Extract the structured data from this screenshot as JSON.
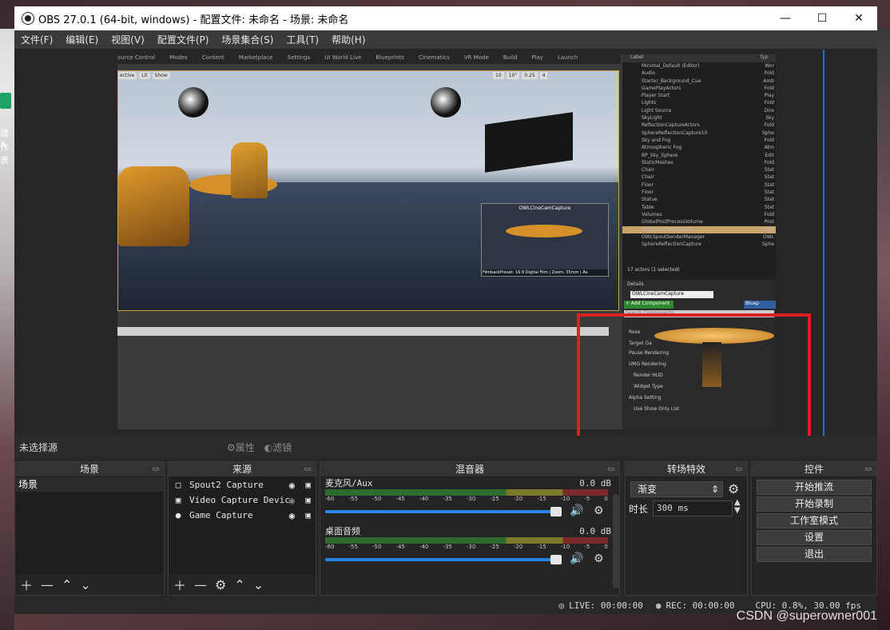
{
  "window": {
    "title": "OBS 27.0.1 (64-bit, windows) - 配置文件: 未命名 - 场景: 未命名"
  },
  "menu": [
    "文件(F)",
    "编辑(E)",
    "视图(V)",
    "配置文件(P)",
    "场景集合(S)",
    "工具(T)",
    "帮助(H)"
  ],
  "desktop": {
    "left_text": [
      "建 X",
      "作表"
    ]
  },
  "ue": {
    "top_tabs": [
      "ource Control",
      "Modes",
      "Content",
      "Marketplace",
      "Settings",
      "UI World Live",
      "Blueprints",
      "Cinematics",
      "VR Mode",
      "Build",
      "Play",
      "Launch"
    ],
    "view_buttons": [
      "ective",
      "Lit",
      "Show"
    ],
    "snap_values": [
      "10",
      "10°",
      "0.25",
      "4"
    ],
    "pip_title": "OWLCineCamCapture",
    "pip_caption": "FilmbackPreset: 16:9 Digital Film | Zoom: 35mm | Av.",
    "outliner_header": {
      "label": "Label",
      "type": "Typ"
    },
    "outliner_rows": [
      {
        "name": "Minimal_Default (Editor)",
        "type": "Wor"
      },
      {
        "name": "Audio",
        "type": "Fold"
      },
      {
        "name": "Starter_Background_Cue",
        "type": "Amb"
      },
      {
        "name": "GamePlayActors",
        "type": "Fold"
      },
      {
        "name": "Player Start",
        "type": "Play"
      },
      {
        "name": "Lights",
        "type": "Fold"
      },
      {
        "name": "Light Source",
        "type": "Dire"
      },
      {
        "name": "SkyLight",
        "type": "Sky"
      },
      {
        "name": "ReflectionCaptureActors",
        "type": "Fold"
      },
      {
        "name": "SphereReflectionCapture10",
        "type": "Sphe"
      },
      {
        "name": "Sky and Fog",
        "type": "Fold"
      },
      {
        "name": "Atmospheric Fog",
        "type": "Atm"
      },
      {
        "name": "BP_Sky_Sphere",
        "type": "Edit"
      },
      {
        "name": "StaticMeshes",
        "type": "Fold"
      },
      {
        "name": "Chair",
        "type": "Stat"
      },
      {
        "name": "Chair",
        "type": "Stat"
      },
      {
        "name": "Floor",
        "type": "Stat"
      },
      {
        "name": "Floor",
        "type": "Stat"
      },
      {
        "name": "Statue",
        "type": "Stat"
      },
      {
        "name": "Table",
        "type": "Stat"
      },
      {
        "name": "Volumes",
        "type": "Fold"
      },
      {
        "name": "GlobalPostProcessVolume",
        "type": "Post"
      },
      {
        "name": "OWLCineCamCapture",
        "type": "OWL"
      },
      {
        "name": "OWLSpoutSenderManager",
        "type": "OWL"
      },
      {
        "name": "SphereReflectionCapture",
        "type": "Sphe"
      }
    ],
    "actor_count": "17 actors (1 selected)",
    "details_tab": "Details",
    "details_name": "OWLCineCamCapture",
    "add_component": "+ Add Component",
    "blueprint": "Bluep",
    "search_components": "Search Components",
    "detail_rows": [
      "Rese",
      "Target Ga",
      "Pause Rendering",
      "UMG Rendering",
      "Render HUD",
      "Widget Type",
      "Alpha Setting",
      "Use Show Only List"
    ]
  },
  "source_bar": {
    "no_source": "未选择源",
    "properties": "属性",
    "filters": "滤镜"
  },
  "panels": {
    "scenes": {
      "title": "场景",
      "items": [
        "场景"
      ]
    },
    "sources": {
      "title": "来源",
      "items": [
        "Spout2 Capture",
        "Video Capture Devic",
        "Game Capture"
      ]
    },
    "mixer": {
      "title": "混音器",
      "channels": [
        {
          "name": "麦克风/Aux",
          "db": "0.0 dB"
        },
        {
          "name": "桌面音频",
          "db": "0.0 dB"
        }
      ],
      "ticks": [
        "-60",
        "-55",
        "-50",
        "-45",
        "-40",
        "-35",
        "-30",
        "-25",
        "-20",
        "-15",
        "-10",
        "-5",
        "0"
      ]
    },
    "transitions": {
      "title": "转场特效",
      "selected": "渐变",
      "duration_label": "时长",
      "duration_value": "300 ms"
    },
    "controls": {
      "title": "控件",
      "buttons": [
        "开始推流",
        "开始录制",
        "工作室模式",
        "设置",
        "退出"
      ]
    }
  },
  "status": {
    "live": "LIVE: 00:00:00",
    "rec": "REC: 00:00:00",
    "cpu": "CPU: 0.8%, 30.00 fps"
  },
  "watermark": "CSDN @superowner001"
}
